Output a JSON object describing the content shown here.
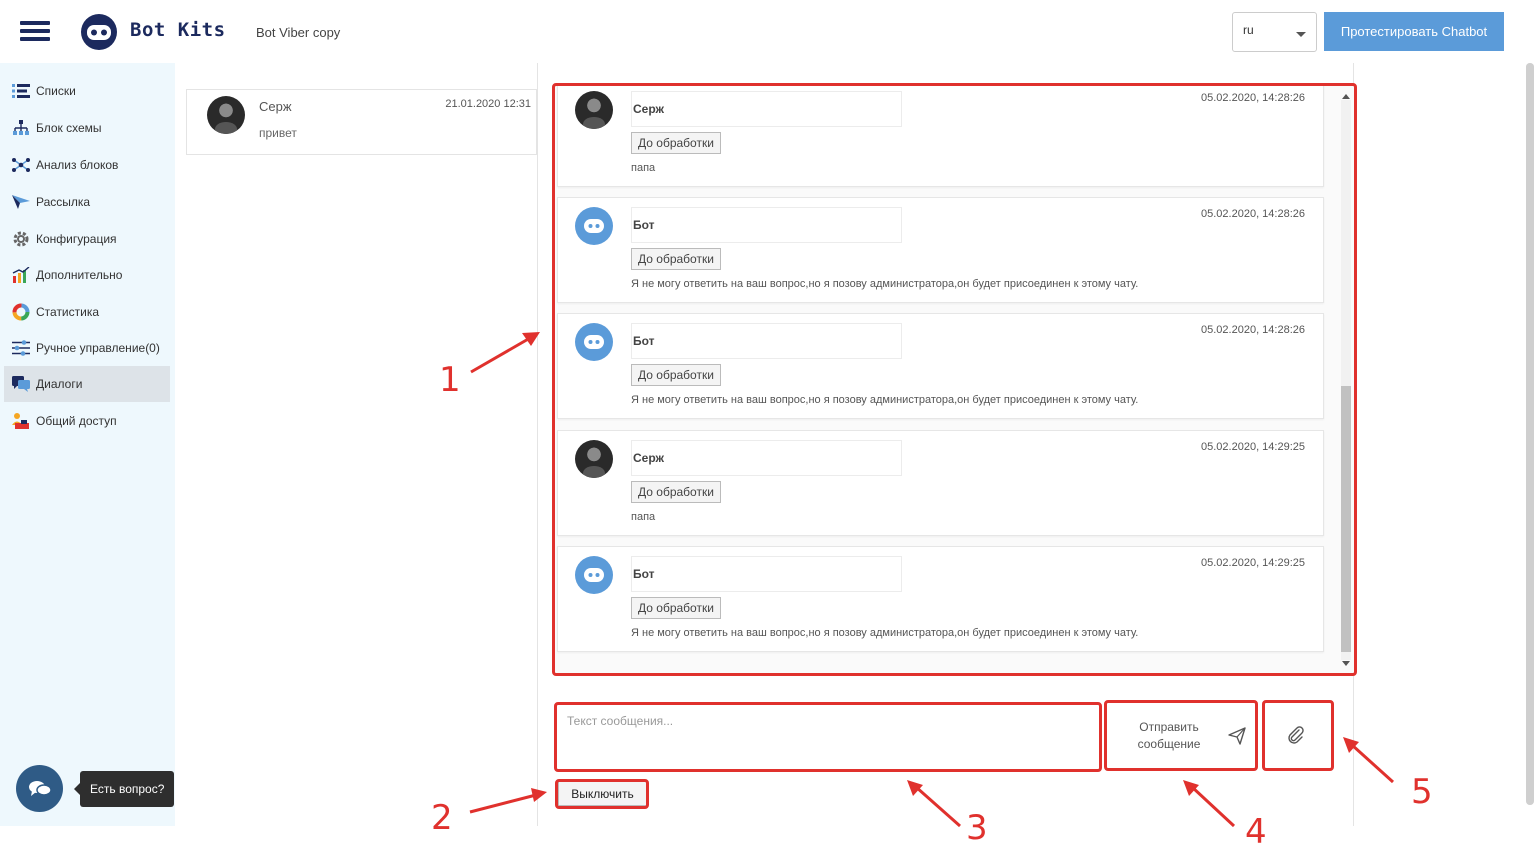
{
  "header": {
    "brand": "Bot Kits",
    "bot_name": "Bot Viber copy",
    "language": "ru",
    "test_button": "Протестировать Chatbot"
  },
  "sidebar": {
    "items": [
      {
        "label": "Списки",
        "icon": "list-icon"
      },
      {
        "label": "Блок схемы",
        "icon": "flowchart-icon"
      },
      {
        "label": "Анализ блоков",
        "icon": "block-analysis-icon"
      },
      {
        "label": "Рассылка",
        "icon": "send-plane-icon"
      },
      {
        "label": "Конфигурация",
        "icon": "gear-icon"
      },
      {
        "label": "Дополнительно",
        "icon": "bar-chart-icon"
      },
      {
        "label": "Статистика",
        "icon": "donut-chart-icon"
      },
      {
        "label": "Ручное управление(0)",
        "icon": "sliders-icon"
      },
      {
        "label": "Диалоги",
        "icon": "chat-icon",
        "active": true
      },
      {
        "label": "Общий доступ",
        "icon": "shared-access-icon"
      }
    ]
  },
  "dialog_list": [
    {
      "name": "Серж",
      "last_message": "привет",
      "date": "21.01.2020 12:31"
    }
  ],
  "messages": [
    {
      "sender": "Серж",
      "type": "user",
      "timestamp": "05.02.2020, 14:28:26",
      "stage_label": "До обработки",
      "text": "папа"
    },
    {
      "sender": "Бот",
      "type": "bot",
      "timestamp": "05.02.2020, 14:28:26",
      "stage_label": "До обработки",
      "text": "Я не могу ответить на ваш вопрос,но я позову администратора,он будет присоединен к этому чату."
    },
    {
      "sender": "Бот",
      "type": "bot",
      "timestamp": "05.02.2020, 14:28:26",
      "stage_label": "До обработки",
      "text": "Я не могу ответить на ваш вопрос,но я позову администратора,он будет присоединен к этому чату."
    },
    {
      "sender": "Серж",
      "type": "user",
      "timestamp": "05.02.2020, 14:29:25",
      "stage_label": "До обработки",
      "text": "папа"
    },
    {
      "sender": "Бот",
      "type": "bot",
      "timestamp": "05.02.2020, 14:29:25",
      "stage_label": "До обработки",
      "text": "Я не могу ответить на ваш вопрос,но я позову администратора,он будет присоединен к этому чату."
    }
  ],
  "composer": {
    "placeholder": "Текст сообщения...",
    "send_label": "Отправить сообщение",
    "disable_label": "Выключить"
  },
  "help": {
    "tooltip": "Есть вопрос?"
  },
  "annotations": [
    "1",
    "2",
    "3",
    "4",
    "5"
  ],
  "colors": {
    "accent": "#5b9bd9",
    "brand": "#1c2a5e",
    "sidebar_bg": "#eef8fd",
    "annotation": "#e0312d"
  }
}
